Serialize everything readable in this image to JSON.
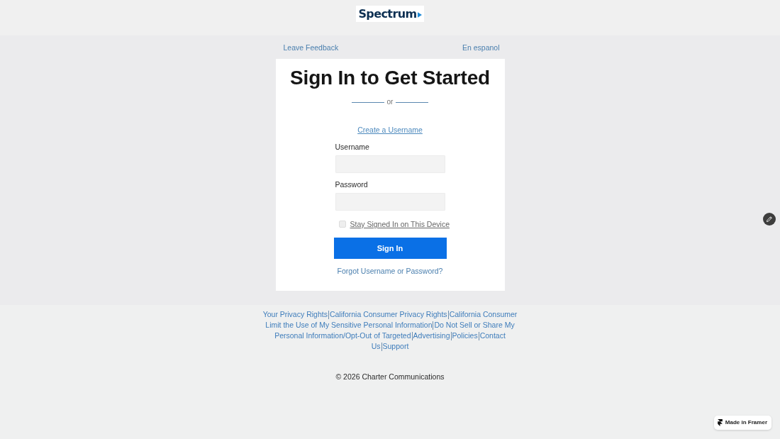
{
  "logo": {
    "text": "Spectrum"
  },
  "top_links": {
    "feedback": "Leave Feedback",
    "language": "En espanol"
  },
  "card": {
    "title": "Sign In to Get Started",
    "divider_text": "or",
    "create_link": "Create a Username",
    "fields": [
      {
        "label": "Username"
      },
      {
        "label": "Password"
      }
    ],
    "remember": {
      "label": "Stay Signed In on This Device",
      "checked": false
    },
    "submit": "Sign In",
    "forgot_link": "Forgot Username or Password?"
  },
  "footer": {
    "link_lines": [
      [
        "Your Privacy Rights",
        "California Consumer Privacy Rights",
        "California Consumer"
      ],
      [
        "Limit the Use of My Sensitive Personal Information",
        "Do Not Sell or Share My"
      ],
      [
        "Personal Information/Opt-Out of Targeted",
        "Advertising",
        "Policies",
        "Contact"
      ],
      [
        "Us",
        "Support"
      ]
    ],
    "copyright": "© 2026 Charter Communications"
  },
  "framer_badge": {
    "text": "Made in Framer"
  }
}
